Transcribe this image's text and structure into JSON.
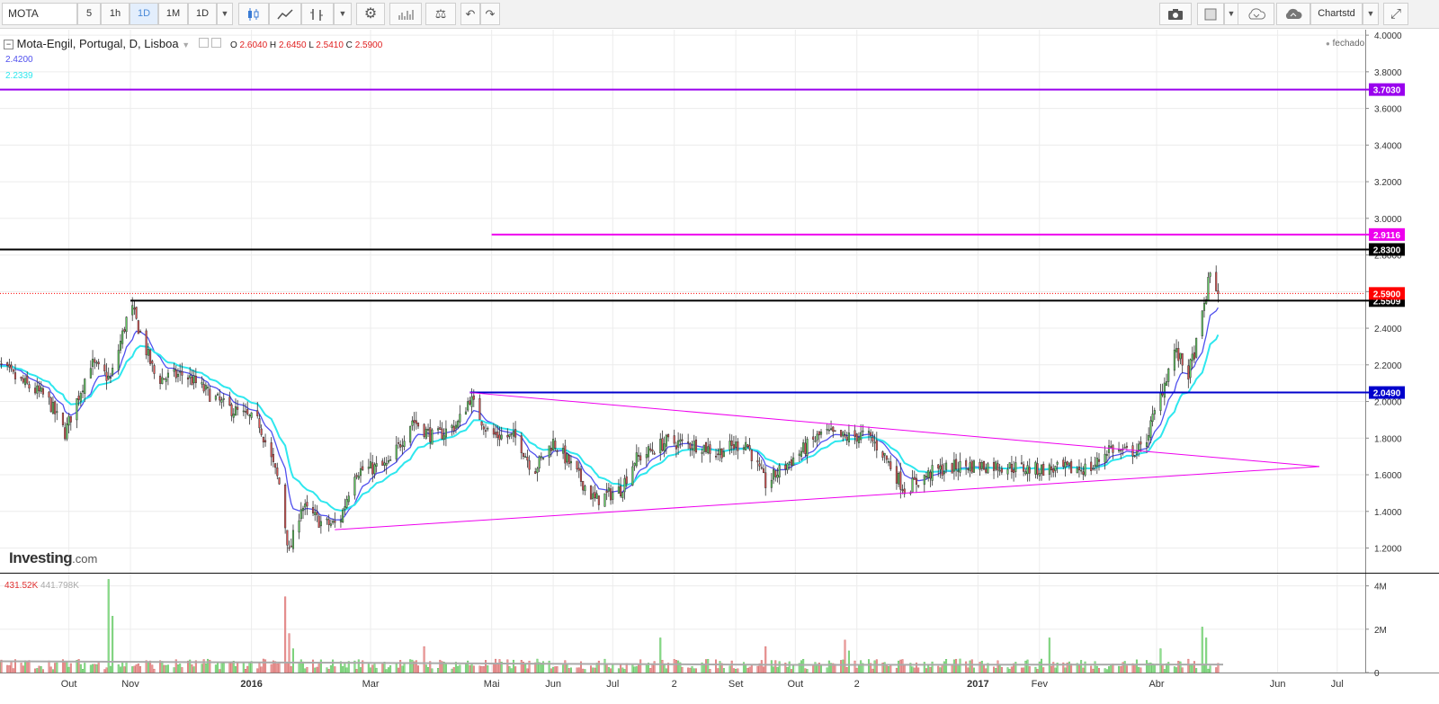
{
  "toolbar": {
    "symbol": "MOTA",
    "intervals": [
      "5",
      "1h",
      "1D",
      "1M",
      "1D"
    ],
    "active_interval_index": 2,
    "chart_type_icon": "candlestick-icon",
    "right_label": "Chartstd"
  },
  "legend": {
    "name": "Mota-Engil, Portugal, D, Lisboa",
    "o_label": "O",
    "o": "2.6040",
    "h_label": "H",
    "h": "2.6450",
    "l_label": "L",
    "l": "2.5410",
    "c_label": "C",
    "c": "2.5900",
    "ma_fast": "2.4200",
    "ma_slow": "2.2339",
    "status": "fechado",
    "volume": "431.52K",
    "volume_ma": "441.798K"
  },
  "logo": {
    "brand": "Investing",
    "domain": ".com"
  },
  "colors": {
    "up": "#62d261",
    "down": "#e35453",
    "ma_fast": "#5050ee",
    "ma_slow": "#2ee7ee",
    "purple": "#9900ee",
    "magenta": "#ee00ee",
    "blue": "#0000cc",
    "black": "#000000",
    "last": "#ff0000"
  },
  "chart_data": {
    "type": "candlestick",
    "title": "Mota-Engil, Portugal, D, Lisboa",
    "y_ticks": [
      1.2,
      1.4,
      1.6,
      1.8,
      2.0,
      2.2,
      2.4,
      2.6,
      2.8,
      3.0,
      3.2,
      3.4,
      3.6,
      3.8,
      4.0
    ],
    "y_tick_labels": [
      "1.2000",
      "1.4000",
      "1.6000",
      "1.8000",
      "2.0000",
      "2.2000",
      "2.4000",
      "2.6000",
      "2.8000",
      "3.0000",
      "3.2000",
      "3.4000",
      "3.6000",
      "3.8000",
      "4.0000"
    ],
    "ylim": [
      1.07,
      4.03
    ],
    "x_ticks": [
      {
        "label": "Out",
        "date": "2015-10-01",
        "bold": false
      },
      {
        "label": "Nov",
        "date": "2015-11-01",
        "bold": false
      },
      {
        "label": "2016",
        "date": "2016-01-01",
        "bold": true
      },
      {
        "label": "Mar",
        "date": "2016-03-01",
        "bold": false
      },
      {
        "label": "Mai",
        "date": "2016-05-01",
        "bold": false
      },
      {
        "label": "Jun",
        "date": "2016-06-01",
        "bold": false
      },
      {
        "label": "Jul",
        "date": "2016-07-01",
        "bold": false
      },
      {
        "label": "2",
        "date": "2016-08-01",
        "bold": false
      },
      {
        "label": "Set",
        "date": "2016-09-01",
        "bold": false
      },
      {
        "label": "Out",
        "date": "2016-10-01",
        "bold": false
      },
      {
        "label": "2",
        "date": "2016-11-01",
        "bold": false
      },
      {
        "label": "2017",
        "date": "2017-01-01",
        "bold": true
      },
      {
        "label": "Fev",
        "date": "2017-02-01",
        "bold": false
      },
      {
        "label": "Abr",
        "date": "2017-04-01",
        "bold": false
      },
      {
        "label": "Jun",
        "date": "2017-06-01",
        "bold": false
      },
      {
        "label": "Jul",
        "date": "2017-07-01",
        "bold": false
      }
    ],
    "price_anchors": [
      [
        "2015-08-24",
        2.22
      ],
      [
        "2015-09-05",
        2.12
      ],
      [
        "2015-09-20",
        2.02
      ],
      [
        "2015-09-29",
        1.83
      ],
      [
        "2015-10-12",
        2.21
      ],
      [
        "2015-10-22",
        2.12
      ],
      [
        "2015-11-01",
        2.53
      ],
      [
        "2015-11-14",
        2.12
      ],
      [
        "2015-11-28",
        2.15
      ],
      [
        "2015-12-18",
        1.98
      ],
      [
        "2016-01-05",
        1.88
      ],
      [
        "2016-01-15",
        1.55
      ],
      [
        "2016-01-20",
        1.17
      ],
      [
        "2016-01-26",
        1.43
      ],
      [
        "2016-02-06",
        1.33
      ],
      [
        "2016-02-14",
        1.33
      ],
      [
        "2016-02-22",
        1.62
      ],
      [
        "2016-03-10",
        1.65
      ],
      [
        "2016-03-22",
        1.9
      ],
      [
        "2016-04-02",
        1.8
      ],
      [
        "2016-04-14",
        1.88
      ],
      [
        "2016-04-20",
        2.02
      ],
      [
        "2016-04-30",
        1.82
      ],
      [
        "2016-05-14",
        1.8
      ],
      [
        "2016-05-22",
        1.62
      ],
      [
        "2016-06-01",
        1.78
      ],
      [
        "2016-06-10",
        1.65
      ],
      [
        "2016-06-22",
        1.46
      ],
      [
        "2016-07-05",
        1.52
      ],
      [
        "2016-07-12",
        1.68
      ],
      [
        "2016-07-28",
        1.78
      ],
      [
        "2016-08-15",
        1.76
      ],
      [
        "2016-08-22",
        1.72
      ],
      [
        "2016-09-06",
        1.78
      ],
      [
        "2016-09-16",
        1.55
      ],
      [
        "2016-10-01",
        1.7
      ],
      [
        "2016-10-15",
        1.83
      ],
      [
        "2016-10-26",
        1.8
      ],
      [
        "2016-11-06",
        1.82
      ],
      [
        "2016-11-14",
        1.72
      ],
      [
        "2016-11-25",
        1.52
      ],
      [
        "2016-12-10",
        1.62
      ],
      [
        "2016-12-24",
        1.65
      ],
      [
        "2017-01-10",
        1.65
      ],
      [
        "2017-01-28",
        1.63
      ],
      [
        "2017-02-18",
        1.63
      ],
      [
        "2017-02-28",
        1.64
      ],
      [
        "2017-03-08",
        1.75
      ],
      [
        "2017-03-15",
        1.72
      ],
      [
        "2017-03-25",
        1.74
      ],
      [
        "2017-04-02",
        2.0
      ],
      [
        "2017-04-10",
        2.28
      ],
      [
        "2017-04-17",
        2.15
      ],
      [
        "2017-04-22",
        2.35
      ],
      [
        "2017-04-28",
        2.7
      ],
      [
        "2017-05-02",
        2.59
      ]
    ],
    "last_candle": {
      "date": "2017-05-02",
      "open": 2.604,
      "high": 2.645,
      "low": 2.541,
      "close": 2.59
    },
    "series": [
      {
        "name": "Mota-Engil",
        "type": "candlestick"
      },
      {
        "name": "MA fast",
        "type": "line",
        "last": 2.42
      },
      {
        "name": "MA slow",
        "type": "line",
        "last": 2.2339
      }
    ],
    "horizontal_lines": [
      {
        "value": 3.703,
        "label": "3.7030",
        "color": "#9900ee",
        "from": "2015-08-24"
      },
      {
        "value": 2.9116,
        "label": "2.9116",
        "color": "#ee00ee",
        "from": "2016-05-01"
      },
      {
        "value": 2.83,
        "label": "2.8300",
        "color": "#000000",
        "from": "2015-08-24"
      },
      {
        "value": 2.5509,
        "label": "2.5509",
        "color": "#000000",
        "from": "2015-11-01"
      },
      {
        "value": 2.049,
        "label": "2.0490",
        "color": "#0000cc",
        "from": "2016-04-20"
      }
    ],
    "last_price": {
      "value": 2.59,
      "label": "2.5900",
      "color": "#ff0000"
    },
    "trendlines": [
      {
        "from": {
          "date": "2016-04-20",
          "value": 2.049
        },
        "to": {
          "date": "2017-06-22",
          "value": 1.645
        },
        "color": "#ee00ee"
      },
      {
        "from": {
          "date": "2016-02-12",
          "value": 1.3
        },
        "to": {
          "date": "2017-06-22",
          "value": 1.645
        },
        "color": "#ee00ee"
      }
    ],
    "volume": {
      "unit": "M",
      "y_ticks": [
        0,
        2,
        4
      ],
      "y_tick_labels": [
        "0",
        "2M",
        "4M"
      ],
      "ylim": [
        0,
        4.4
      ],
      "typical": 0.35,
      "spikes": [
        {
          "date": "2015-10-23",
          "value": 4.3
        },
        {
          "date": "2015-10-25",
          "value": 2.6
        },
        {
          "date": "2016-01-20",
          "value": 3.5
        },
        {
          "date": "2016-01-22",
          "value": 1.8
        },
        {
          "date": "2016-01-24",
          "value": 1.1
        },
        {
          "date": "2016-03-28",
          "value": 1.2
        },
        {
          "date": "2016-07-25",
          "value": 1.6
        },
        {
          "date": "2016-09-18",
          "value": 1.2
        },
        {
          "date": "2016-10-28",
          "value": 1.5
        },
        {
          "date": "2016-10-30",
          "value": 1.0
        },
        {
          "date": "2017-02-07",
          "value": 1.6
        },
        {
          "date": "2017-04-04",
          "value": 1.1
        },
        {
          "date": "2017-04-24",
          "value": 2.1
        },
        {
          "date": "2017-04-28",
          "value": 1.6
        }
      ],
      "ma_level": 0.42
    }
  }
}
